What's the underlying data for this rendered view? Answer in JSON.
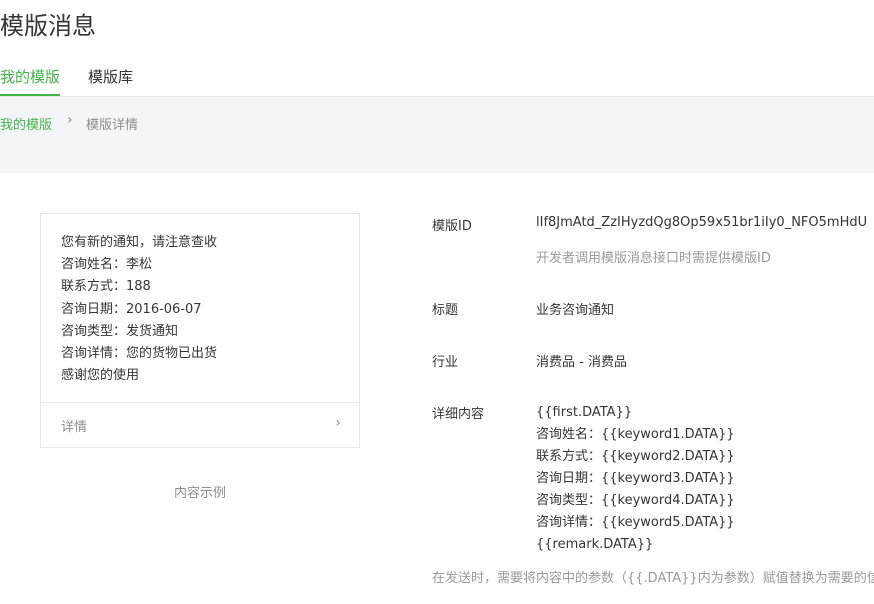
{
  "page": {
    "title": "模版消息"
  },
  "tabs": [
    {
      "label": "我的模版",
      "active": true
    },
    {
      "label": "模版库",
      "active": false
    }
  ],
  "breadcrumb": {
    "link": "我的模版",
    "separator": "›",
    "current": "模版详情"
  },
  "preview": {
    "lines": [
      "您有新的通知，请注意查收",
      "咨询姓名：李松",
      "联系方式：188",
      "咨询日期：2016-06-07",
      "咨询类型：发货通知",
      "咨询详情：您的货物已出货",
      "感谢您的使用"
    ],
    "detail_label": "详情",
    "detail_arrow": "›",
    "caption": "内容示例"
  },
  "info": {
    "template_id_label": "模版ID",
    "template_id_value": "lIf8JmAtd_ZzIHyzdQg8Op59x51br1iIy0_NFO5mHdU",
    "template_id_tip": "开发者调用模版消息接口时需提供模版ID",
    "title_label": "标题",
    "title_value": "业务咨询通知",
    "industry_label": "行业",
    "industry_value": "消费品 - 消费品",
    "content_label": "详细内容",
    "content_lines": [
      "{{first.DATA}}",
      "咨询姓名：{{keyword1.DATA}}",
      "联系方式：{{keyword2.DATA}}",
      "咨询日期：{{keyword3.DATA}}",
      "咨询类型：{{keyword4.DATA}}",
      "咨询详情：{{keyword5.DATA}}",
      "{{remark.DATA}}"
    ],
    "bottom_tip": "在发送时，需要将内容中的参数（{{.DATA}}内为参数）赋值替换为需要的信息"
  },
  "colors": {
    "accent": "#44b549",
    "muted": "#8d8d8d",
    "breadcrumb_bg": "#f4f5f9",
    "border": "#e7e7eb"
  }
}
